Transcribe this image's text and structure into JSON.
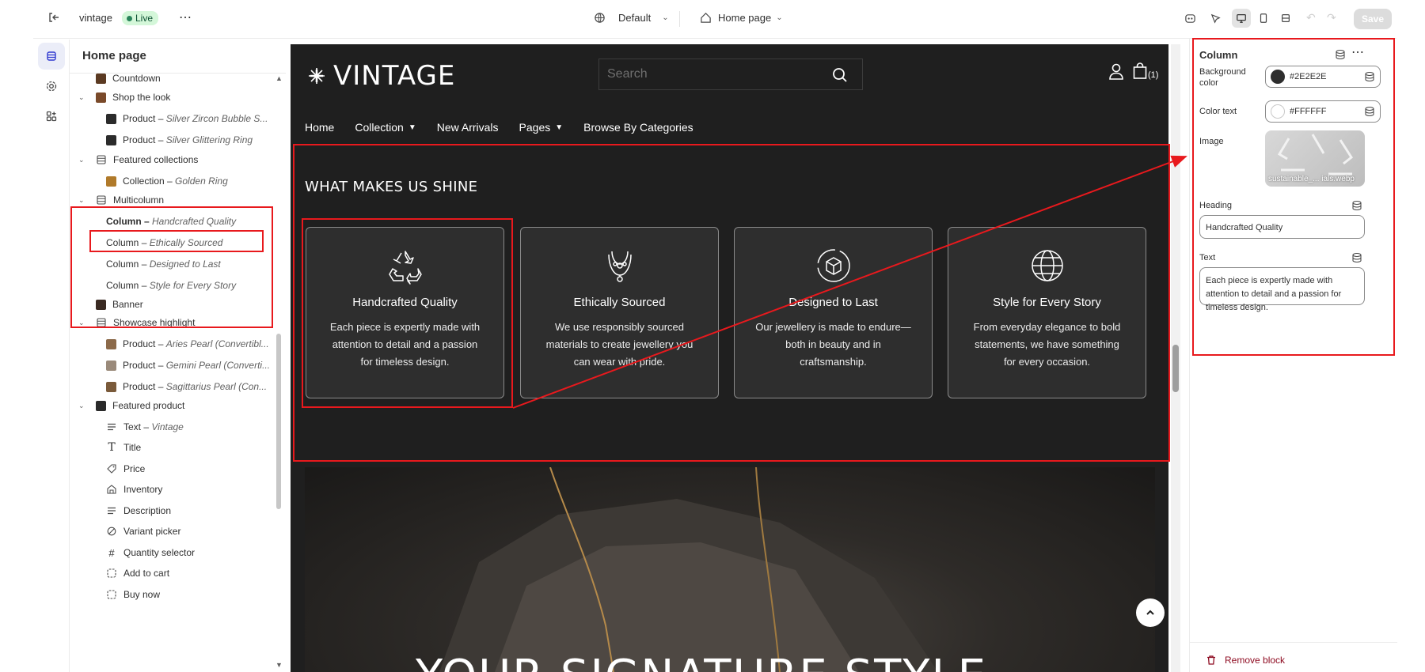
{
  "topbar": {
    "store_name": "vintage",
    "live_label": "Live",
    "theme_label": "Default",
    "page_label": "Home page",
    "save_label": "Save"
  },
  "left_panel": {
    "title": "Home page",
    "items": [
      {
        "label": "Countdown",
        "detail": ""
      },
      {
        "label": "Shop the look",
        "detail": ""
      },
      {
        "label": "Product",
        "detail": "Silver Zircon Bubble S..."
      },
      {
        "label": "Product",
        "detail": "Silver Glittering Ring"
      },
      {
        "label": "Featured collections",
        "detail": ""
      },
      {
        "label": "Collection",
        "detail": "Golden Ring"
      },
      {
        "label": "Multicolumn",
        "detail": ""
      },
      {
        "label": "Column",
        "detail": "Handcrafted Quality"
      },
      {
        "label": "Column",
        "detail": "Ethically Sourced"
      },
      {
        "label": "Column",
        "detail": "Designed to Last"
      },
      {
        "label": "Column",
        "detail": "Style for Every Story"
      },
      {
        "label": "Banner",
        "detail": ""
      },
      {
        "label": "Showcase highlight",
        "detail": ""
      },
      {
        "label": "Product",
        "detail": "Aries Pearl (Convertibl..."
      },
      {
        "label": "Product",
        "detail": "Gemini Pearl (Converti..."
      },
      {
        "label": "Product",
        "detail": "Sagittarius Pearl (Con..."
      },
      {
        "label": "Featured product",
        "detail": ""
      },
      {
        "label": "Text",
        "detail": "Vintage"
      },
      {
        "label": "Title",
        "detail": ""
      },
      {
        "label": "Price",
        "detail": ""
      },
      {
        "label": "Inventory",
        "detail": ""
      },
      {
        "label": "Description",
        "detail": ""
      },
      {
        "label": "Variant picker",
        "detail": ""
      },
      {
        "label": "Quantity selector",
        "detail": ""
      },
      {
        "label": "Add to cart",
        "detail": ""
      },
      {
        "label": "Buy now",
        "detail": ""
      }
    ]
  },
  "preview": {
    "logo_text": "VINTAGE",
    "search_placeholder": "Search",
    "cart_count": "(1)",
    "nav": [
      "Home",
      "Collection",
      "New Arrivals",
      "Pages",
      "Browse By Categories"
    ],
    "section_heading": "WHAT MAKES US SHINE",
    "columns": [
      {
        "title": "Handcrafted Quality",
        "text": "Each piece is expertly made with attention to detail and a passion for timeless design.",
        "icon": "recycle-icon"
      },
      {
        "title": "Ethically Sourced",
        "text": "We use responsibly sourced materials to create jewellery you can wear with pride.",
        "icon": "necklace-icon"
      },
      {
        "title": "Designed to Last",
        "text": "Our jewellery is made to endure—both in beauty and in craftsmanship.",
        "icon": "box-icon"
      },
      {
        "title": "Style for Every Story",
        "text": "From everyday elegance to bold statements, we have something for every occasion.",
        "icon": "globe-icon"
      }
    ],
    "hero_text": "YOUR SIGNATURE STYLE"
  },
  "right_panel": {
    "title": "Column",
    "background_color_label": "Background color",
    "background_color_value": "#2E2E2E",
    "color_text_label": "Color text",
    "color_text_value": "#FFFFFF",
    "image_label": "Image",
    "image_filename": "sustainable_... ials.webp",
    "heading_label": "Heading",
    "heading_value": "Handcrafted Quality",
    "text_label": "Text",
    "text_value": "Each piece is expertly made with attention to detail and a passion for timeless design.",
    "remove_label": "Remove block"
  },
  "colors": {
    "accent": "#e8191d",
    "preview_bg": "#1f1f1f",
    "card_bg": "#2e2e2e",
    "live_badge": "#d4f7d9",
    "remove_text": "#8e0b21"
  }
}
